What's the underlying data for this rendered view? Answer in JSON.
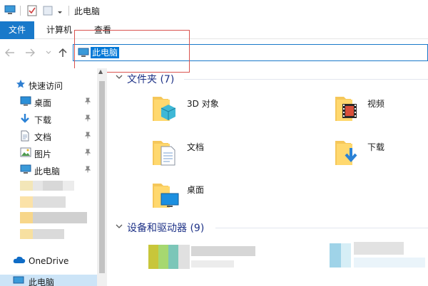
{
  "title_bar": {
    "title": "此电脑"
  },
  "ribbon": {
    "tabs": [
      {
        "label": "文件",
        "active": true
      },
      {
        "label": "计算机",
        "active": false
      },
      {
        "label": "查看",
        "active": false
      }
    ]
  },
  "address": {
    "path": "此电脑"
  },
  "sidebar": {
    "quick_access": "快速访问",
    "items": [
      {
        "label": "桌面",
        "icon": "desktop-icon",
        "pinned": true
      },
      {
        "label": "下载",
        "icon": "download-icon",
        "pinned": true
      },
      {
        "label": "文档",
        "icon": "documents-icon",
        "pinned": true
      },
      {
        "label": "图片",
        "icon": "pictures-icon",
        "pinned": true
      },
      {
        "label": "此电脑",
        "icon": "this-pc-icon",
        "pinned": true
      }
    ],
    "onedrive": "OneDrive",
    "this_pc": "此电脑"
  },
  "main": {
    "folders_header": "文件夹 (7)",
    "folders": [
      {
        "label": "3D 对象",
        "icon": "3d-objects-folder-icon"
      },
      {
        "label": "视频",
        "icon": "videos-folder-icon"
      },
      {
        "label": "文档",
        "icon": "documents-folder-icon"
      },
      {
        "label": "下载",
        "icon": "downloads-folder-icon"
      },
      {
        "label": "桌面",
        "icon": "desktop-folder-icon"
      }
    ],
    "devices_header": "设备和驱动器 (9)"
  },
  "colors": {
    "accent": "#1979ca",
    "selection": "#0078d7",
    "header_text": "#1e3287",
    "annotation": "#d9534f"
  }
}
